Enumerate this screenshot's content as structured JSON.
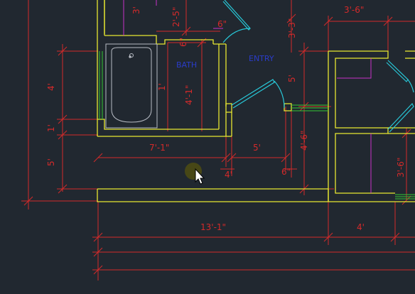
{
  "drawing": {
    "rooms": {
      "bath": "BATH",
      "entry": "ENTRY"
    },
    "dimensions": {
      "d1": "3'-6\"",
      "d2": "2'-5\"",
      "d3": "6\"",
      "d4": "6\"",
      "d5": "3'-3\"",
      "d6": "4'",
      "d7": "5'",
      "d8": "4'-1\"",
      "d9": "1'",
      "d10": "1'",
      "d11": "5'",
      "d12": "7'-1\"",
      "d13": "5'",
      "d14": "4'-6\"",
      "d15": "4'",
      "d16": "6\"",
      "d17": "3'-6\"",
      "d18": "13'-1\"",
      "d19": "4'",
      "d20": "3'"
    },
    "colors": {
      "background": "#212830",
      "walls": "#e8e831",
      "dimensions": "#d42a2a",
      "fixtures": "#b8bcc4",
      "doors": "#28c8d8",
      "room_labels": "#2a3cc8",
      "cabinets": "#c832c8",
      "hatch": "#32c832"
    },
    "cursor": {
      "icon": "arrow-cursor-icon",
      "highlight": "olive-dot"
    }
  }
}
